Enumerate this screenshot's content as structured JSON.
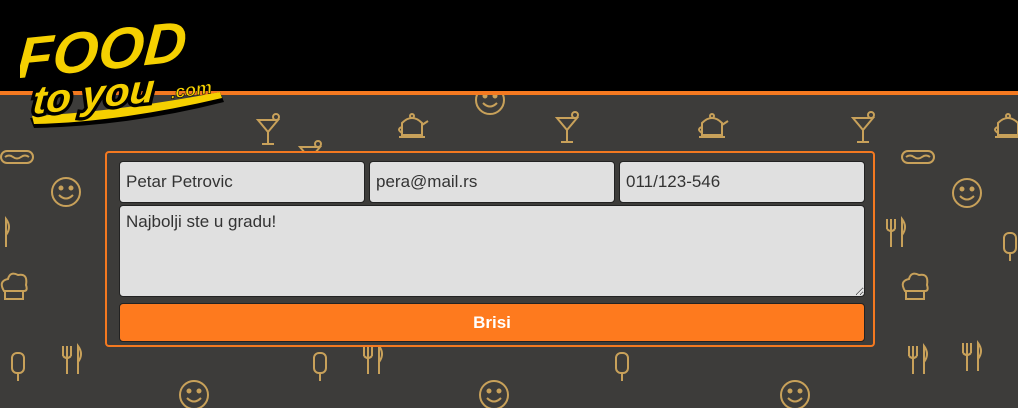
{
  "brand": {
    "logo_top": "FOOD",
    "logo_mid": "to you",
    "logo_suffix": ".com",
    "accent": "#f47920",
    "logo_color": "#f5d000"
  },
  "form": {
    "name_value": "Petar Petrovic",
    "email_value": "pera@mail.rs",
    "phone_value": "011/123-546",
    "message_value": "Najbolji ste u gradu!",
    "delete_label": "Brisi"
  },
  "background_icons": [
    "smiley-icon",
    "cocktail-icon",
    "teapot-icon",
    "hotdog-icon",
    "chef-hat-icon",
    "fork-knife-icon",
    "ice-cream-icon"
  ]
}
